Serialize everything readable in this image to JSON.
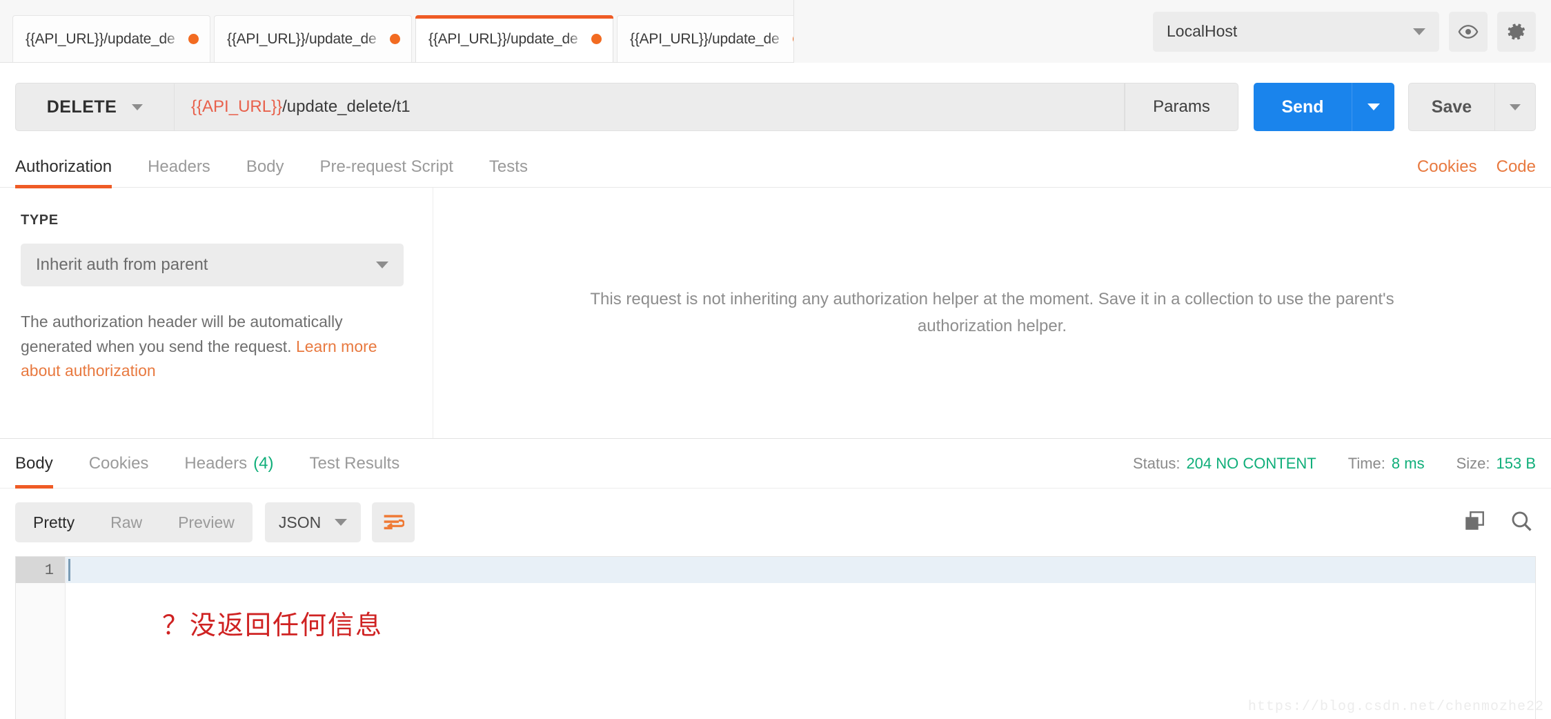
{
  "tabbar": {
    "request_tabs": [
      {
        "label": "{{API_URL}}/update_de",
        "unsaved": true,
        "active": false
      },
      {
        "label": "{{API_URL}}/update_de",
        "unsaved": true,
        "active": false
      },
      {
        "label": "{{API_URL}}/update_de",
        "unsaved": true,
        "active": true
      },
      {
        "label": "{{API_URL}}/update_de",
        "unsaved": true,
        "active": false
      }
    ],
    "new_tab_icon": "plus-icon",
    "more_tabs_icon": "ellipsis-icon"
  },
  "environment": {
    "selected": "LocalHost",
    "eye_icon": "eye-icon",
    "settings_icon": "gear-icon"
  },
  "request": {
    "method": "DELETE",
    "url_variable": "{{API_URL}}",
    "url_path": "/update_delete/t1",
    "params_label": "Params",
    "send_label": "Send",
    "save_label": "Save"
  },
  "request_tabs": {
    "items": [
      {
        "label": "Authorization",
        "active": true
      },
      {
        "label": "Headers",
        "active": false
      },
      {
        "label": "Body",
        "active": false
      },
      {
        "label": "Pre-request Script",
        "active": false
      },
      {
        "label": "Tests",
        "active": false
      }
    ],
    "cookies_link": "Cookies",
    "code_link": "Code"
  },
  "authorization": {
    "type_label": "TYPE",
    "type_value": "Inherit auth from parent",
    "note_text": "The authorization header will be automatically generated when you send the request. ",
    "note_link": "Learn more about authorization",
    "inherit_message": "This request is not inheriting any authorization helper at the moment. Save it in a collection to use the parent's authorization helper."
  },
  "response": {
    "tabs": [
      {
        "label": "Body",
        "count": "",
        "active": true
      },
      {
        "label": "Cookies",
        "count": "",
        "active": false
      },
      {
        "label": "Headers",
        "count": "(4)",
        "active": false
      },
      {
        "label": "Test Results",
        "count": "",
        "active": false
      }
    ],
    "status_label": "Status:",
    "status_value": "204 NO CONTENT",
    "time_label": "Time:",
    "time_value": "8 ms",
    "size_label": "Size:",
    "size_value": "153 B",
    "view_modes": [
      {
        "label": "Pretty",
        "active": true
      },
      {
        "label": "Raw",
        "active": false
      },
      {
        "label": "Preview",
        "active": false
      }
    ],
    "format": "JSON",
    "wrap_icon": "wrap-lines-icon",
    "copy_icon": "copy-icon",
    "search_icon": "search-icon",
    "line_number": "1",
    "body_content": "",
    "annotation": "？没返回任何信息",
    "watermark": "https://blog.csdn.net/chenmozhe22"
  },
  "colors": {
    "accent_orange": "#ef5b25",
    "send_blue": "#1a84ec",
    "status_green": "#0fae79",
    "variable_red": "#e8614c",
    "annotation_red": "#cf2222"
  }
}
